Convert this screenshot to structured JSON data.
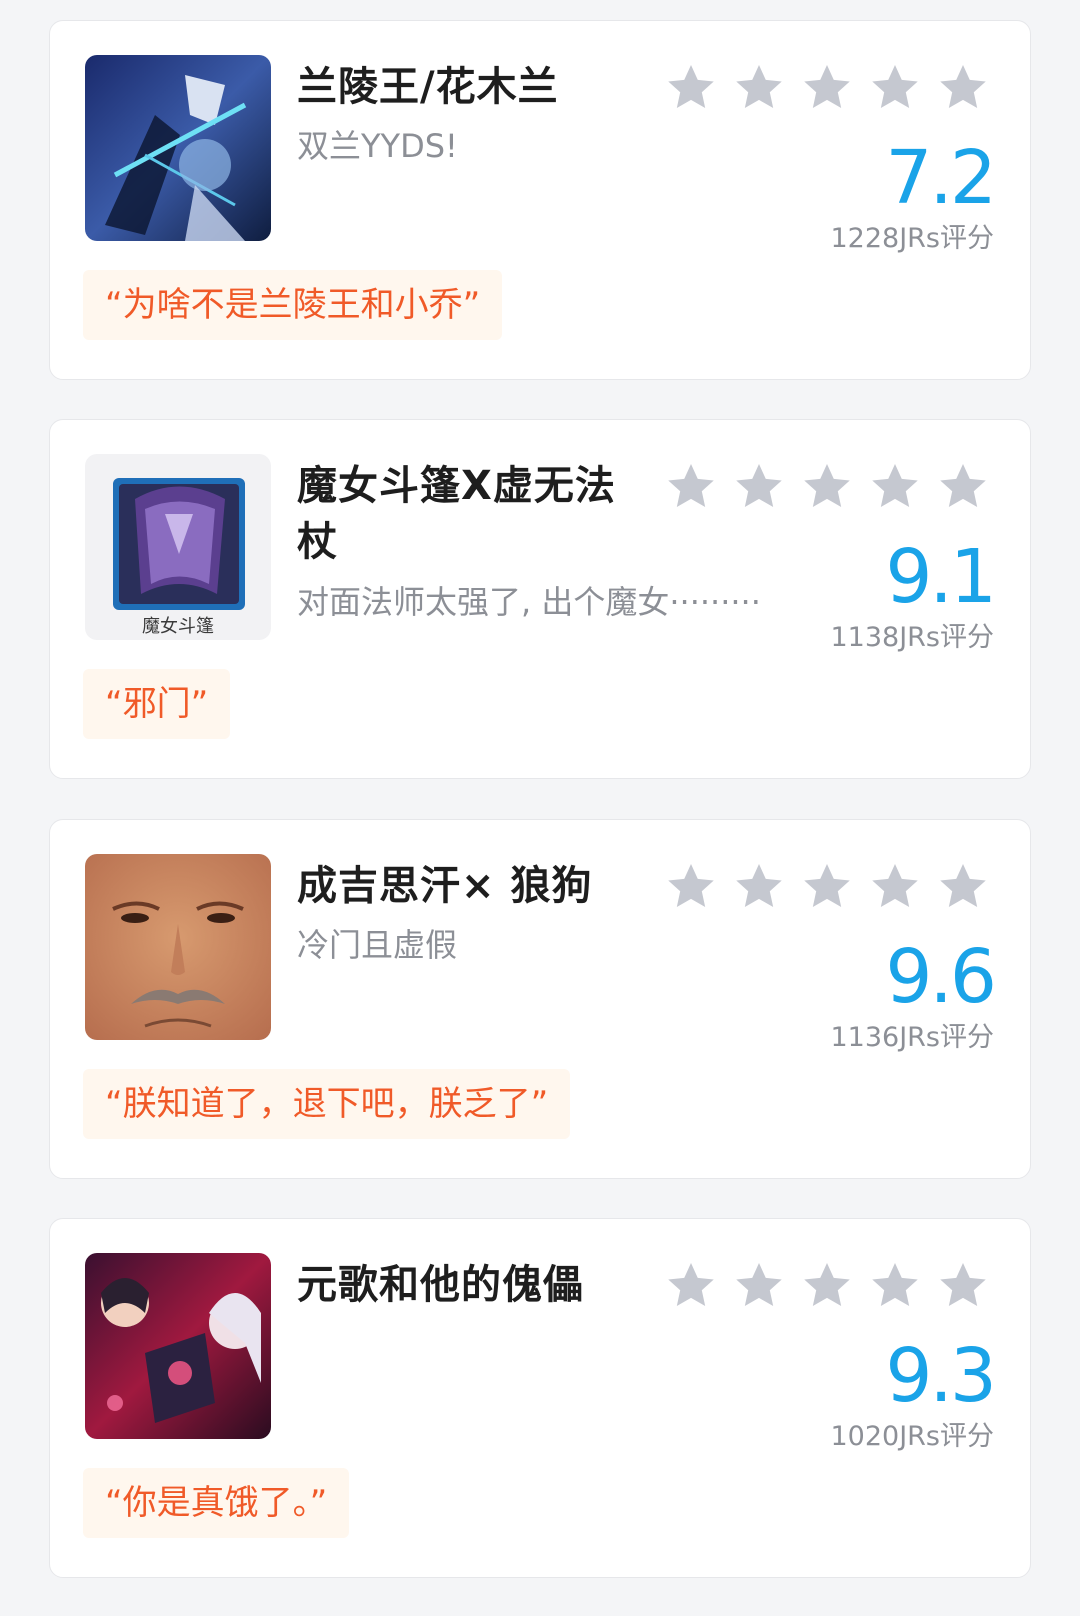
{
  "star_color": "#c5c8d0",
  "score_color": "#1aa3e8",
  "quote_color": "#f05a28",
  "items": [
    {
      "title": "兰陵王/花木兰",
      "subtitle": "双兰YYDS!",
      "score": "7.2",
      "votes": "1228JRs评分",
      "quote": "“为啥不是兰陵王和小乔”",
      "stars_filled": 0,
      "stars_total": 5
    },
    {
      "title": "魔女斗篷X虚无法杖",
      "subtitle": "对面法师太强了, 出个魔女·········",
      "score": "9.1",
      "votes": "1138JRs评分",
      "quote": "“邪门”",
      "thumb_caption": "魔女斗篷",
      "stars_filled": 0,
      "stars_total": 5
    },
    {
      "title": "成吉思汗× 狼狗",
      "subtitle": "冷门且虚假",
      "score": "9.6",
      "votes": "1136JRs评分",
      "quote": "“朕知道了，退下吧，朕乏了”",
      "stars_filled": 0,
      "stars_total": 5
    },
    {
      "title": "元歌和他的傀儡",
      "subtitle": "",
      "score": "9.3",
      "votes": "1020JRs评分",
      "quote": "“你是真饿了。”",
      "stars_filled": 0,
      "stars_total": 5
    }
  ]
}
